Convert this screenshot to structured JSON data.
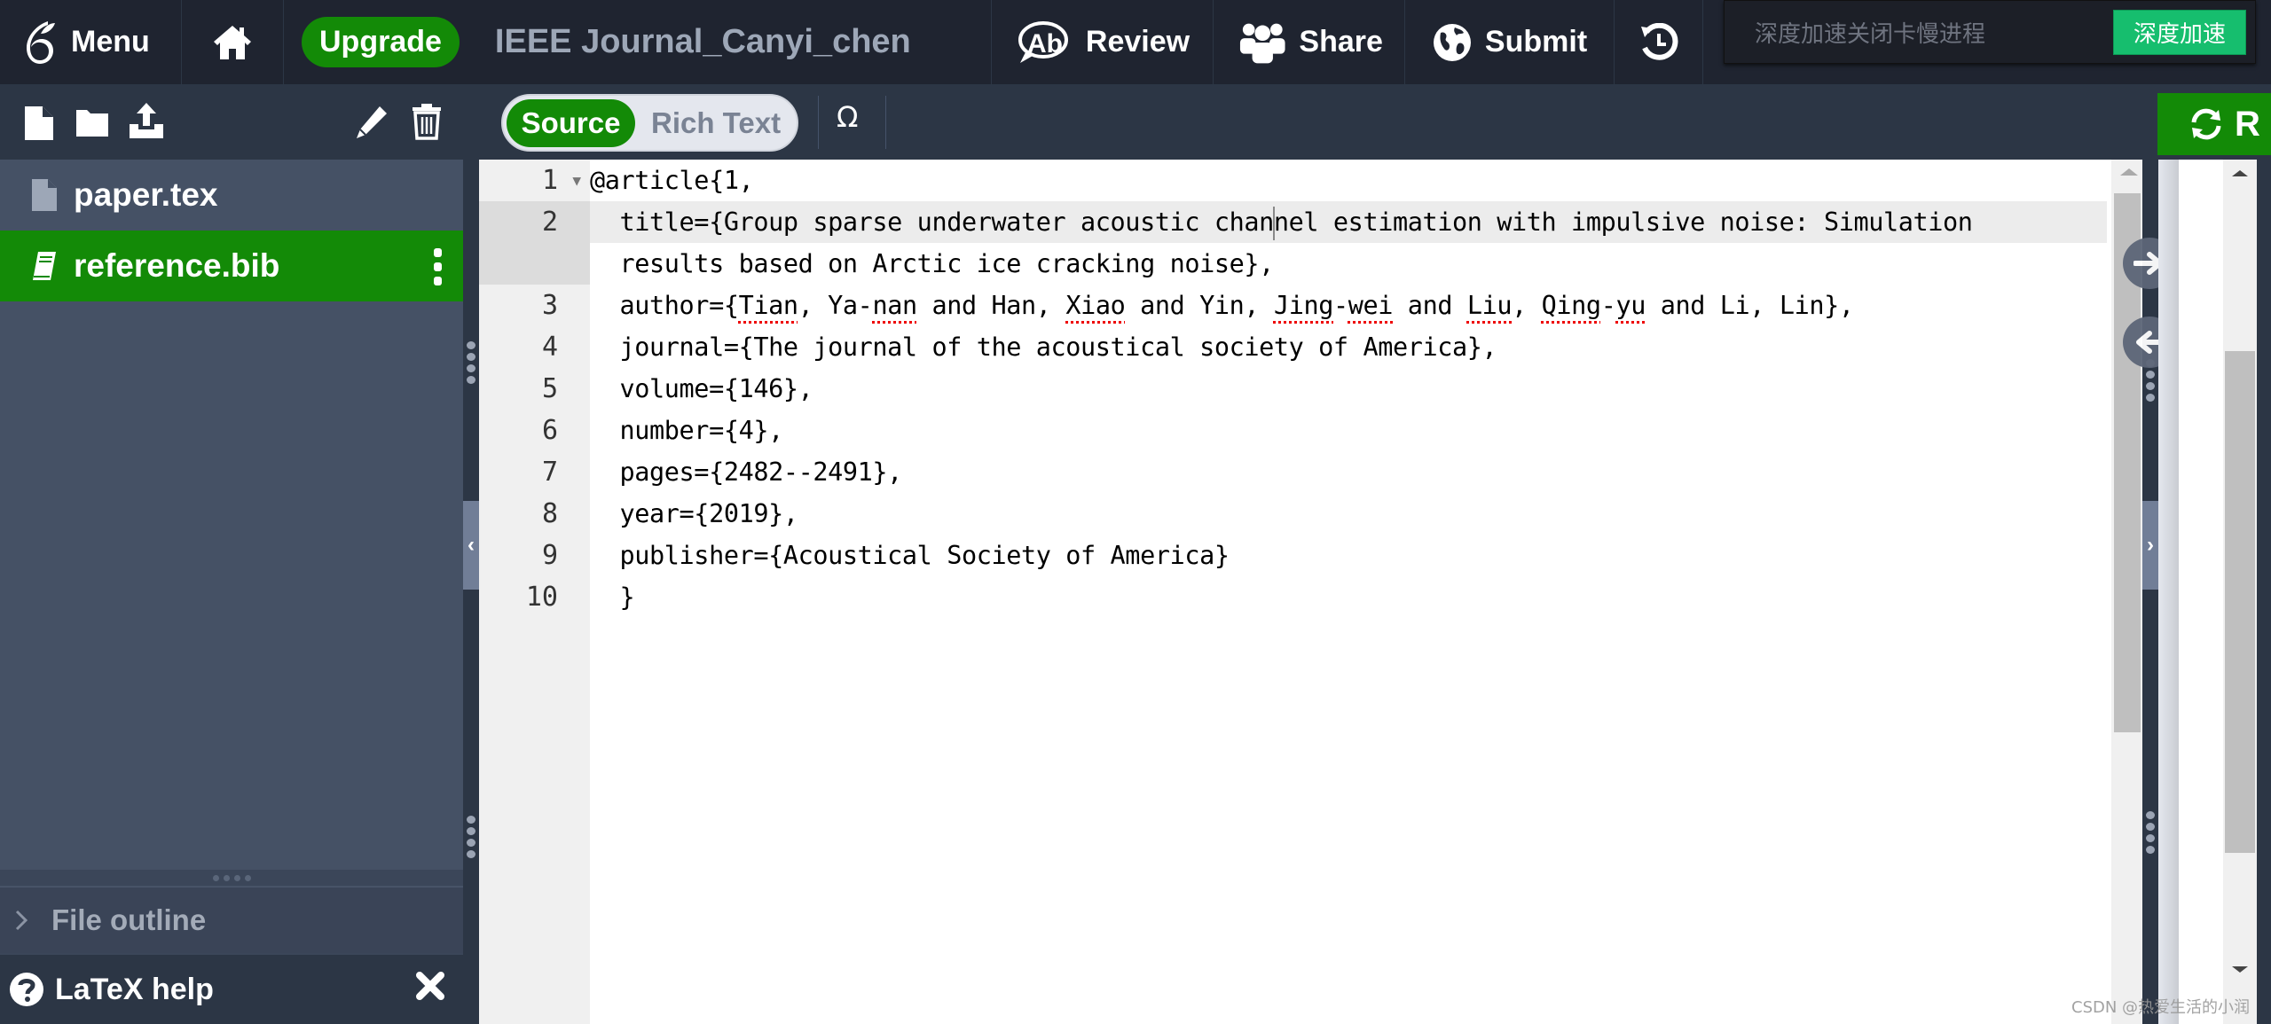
{
  "header": {
    "menu_label": "Menu",
    "upgrade_label": "Upgrade",
    "project_title": "IEEE Journal_Canyi_chen",
    "review_label": "Review",
    "share_label": "Share",
    "submit_label": "Submit"
  },
  "popup": {
    "message": "深度加速关闭卡慢进程",
    "button_label": "深度加速"
  },
  "editor_toolbar": {
    "source_label": "Source",
    "rich_text_label": "Rich Text",
    "symbol_label": "Ω",
    "recompile_label": "R"
  },
  "sidebar": {
    "files": [
      {
        "name": "paper.tex",
        "icon": "file-icon",
        "selected": false
      },
      {
        "name": "reference.bib",
        "icon": "book-icon",
        "selected": true
      }
    ],
    "file_outline_label": "File outline",
    "latex_help_label": "LaTeX help"
  },
  "editor": {
    "lines": [
      {
        "num": "1",
        "text": "@article{1,"
      },
      {
        "num": "2",
        "text": "  title={Group sparse underwater acoustic channel estimation with impulsive noise: Simulation",
        "wrap": "  results based on Arctic ice cracking noise},"
      },
      {
        "num": "3",
        "text": "  author={Tian, Ya-nan and Han, Xiao and Yin, Jing-wei and Liu, Qing-yu and Li, Lin},"
      },
      {
        "num": "4",
        "text": "  journal={The journal of the acoustical society of America},"
      },
      {
        "num": "5",
        "text": "  volume={146},"
      },
      {
        "num": "6",
        "text": "  number={4},"
      },
      {
        "num": "7",
        "text": "  pages={2482--2491},"
      },
      {
        "num": "8",
        "text": "  year={2019},"
      },
      {
        "num": "9",
        "text": "  publisher={Acoustical Society of America}"
      },
      {
        "num": "10",
        "text": "  }"
      }
    ]
  },
  "watermark": "CSDN @热爱生活的小润",
  "colors": {
    "accent_green": "#138a07",
    "header_bg": "#1f2430",
    "toolbar_bg": "#2c3645",
    "sidebar_bg": "#455165",
    "popup_button": "#16be6e"
  }
}
